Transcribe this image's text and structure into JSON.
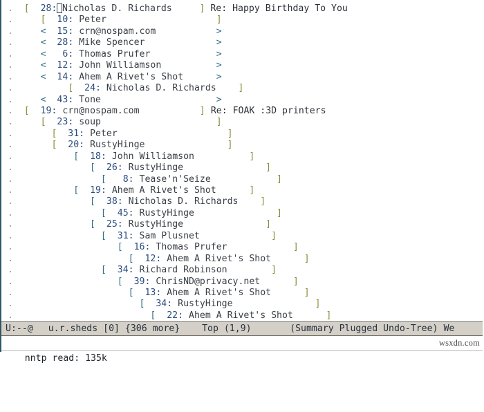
{
  "window": {
    "app": "GNU Emacs - Gnus Summary",
    "frame_border_color": "#2e5866"
  },
  "summary": {
    "dot": ".",
    "lines": [
      {
        "indent": 1,
        "open": "[",
        "close": "]",
        "num": "28",
        "from": "Nicholas D. Richards",
        "pad": 5,
        "cursor_after_num": true,
        "subject": "Re: Happy Birthday To You",
        "root": true
      },
      {
        "indent": 4,
        "open": "[",
        "close": "]",
        "num": "10",
        "from": "Peter",
        "pad": 20,
        "subject": ""
      },
      {
        "indent": 4,
        "open": "<",
        "close": ">",
        "num": "15",
        "from": "crn@nospam.com",
        "pad": 11,
        "subject": ""
      },
      {
        "indent": 4,
        "open": "<",
        "close": ">",
        "num": "28",
        "from": "Mike Spencer",
        "pad": 13,
        "subject": ""
      },
      {
        "indent": 4,
        "open": "<",
        "close": ">",
        "num": "6",
        "from": "Thomas Prufer",
        "pad": 12,
        "subject": ""
      },
      {
        "indent": 4,
        "open": "<",
        "close": ">",
        "num": "12",
        "from": "John Williamson",
        "pad": 10,
        "subject": ""
      },
      {
        "indent": 4,
        "open": "<",
        "close": ">",
        "num": "14",
        "from": "Ahem A Rivet's Shot",
        "pad": 6,
        "subject": ""
      },
      {
        "indent": 9,
        "open": "[",
        "close": "]",
        "num": "24",
        "from": "Nicholas D. Richards",
        "pad": 4,
        "subject": ""
      },
      {
        "indent": 4,
        "open": "<",
        "close": ">",
        "num": "43",
        "from": "Tone",
        "pad": 21,
        "subject": ""
      },
      {
        "indent": 1,
        "open": "[",
        "close": "]",
        "num": "19",
        "from": "crn@nospam.com",
        "pad": 11,
        "subject": "Re: FOAK :3D printers",
        "root": true
      },
      {
        "indent": 4,
        "open": "[",
        "close": "]",
        "num": "23",
        "from": "soup",
        "pad": 21,
        "subject": ""
      },
      {
        "indent": 6,
        "open": "[",
        "close": "]",
        "num": "31",
        "from": "Peter",
        "pad": 20,
        "subject": ""
      },
      {
        "indent": 6,
        "open": "[",
        "close": "]",
        "num": "20",
        "from": "RustyHinge",
        "pad": 15,
        "subject": ""
      },
      {
        "indent": 10,
        "open": "[",
        "close": "]",
        "num": "18",
        "from": "John Williamson",
        "pad": 10,
        "subject": ""
      },
      {
        "indent": 13,
        "open": "[",
        "close": "]",
        "num": "26",
        "from": "RustyHinge",
        "pad": 15,
        "subject": ""
      },
      {
        "indent": 15,
        "open": "[",
        "close": "]",
        "num": "8",
        "from": "Tease'n'Seize",
        "pad": 12,
        "subject": ""
      },
      {
        "indent": 10,
        "open": "[",
        "close": "]",
        "num": "19",
        "from": "Ahem A Rivet's Shot",
        "pad": 6,
        "subject": ""
      },
      {
        "indent": 13,
        "open": "[",
        "close": "]",
        "num": "38",
        "from": "Nicholas D. Richards",
        "pad": 4,
        "subject": ""
      },
      {
        "indent": 15,
        "open": "[",
        "close": "]",
        "num": "45",
        "from": "RustyHinge",
        "pad": 15,
        "subject": ""
      },
      {
        "indent": 13,
        "open": "[",
        "close": "]",
        "num": "25",
        "from": "RustyHinge",
        "pad": 15,
        "subject": ""
      },
      {
        "indent": 15,
        "open": "[",
        "close": "]",
        "num": "31",
        "from": "Sam Plusnet",
        "pad": 13,
        "subject": ""
      },
      {
        "indent": 18,
        "open": "[",
        "close": "]",
        "num": "16",
        "from": "Thomas Prufer",
        "pad": 12,
        "subject": ""
      },
      {
        "indent": 20,
        "open": "[",
        "close": "]",
        "num": "12",
        "from": "Ahem A Rivet's Shot",
        "pad": 6,
        "subject": ""
      },
      {
        "indent": 15,
        "open": "[",
        "close": "]",
        "num": "34",
        "from": "Richard Robinson",
        "pad": 8,
        "subject": ""
      },
      {
        "indent": 18,
        "open": "[",
        "close": "]",
        "num": "39",
        "from": "ChrisND@privacy.net",
        "pad": 6,
        "subject": ""
      },
      {
        "indent": 20,
        "open": "[",
        "close": "]",
        "num": "13",
        "from": "Ahem A Rivet's Shot",
        "pad": 6,
        "subject": ""
      },
      {
        "indent": 22,
        "open": "[",
        "close": "]",
        "num": "34",
        "from": "RustyHinge",
        "pad": 15,
        "subject": ""
      },
      {
        "indent": 24,
        "open": "[",
        "close": "]",
        "num": "22",
        "from": "Ahem A Rivet's Shot",
        "pad": 6,
        "subject": ""
      }
    ]
  },
  "modeline": {
    "mode_flags": "U:--@",
    "icon_name": "gnus-mode-icon",
    "group": "u.r.sheds",
    "unread": "[0]",
    "more": "{306 more}",
    "position": "Top (1,9)",
    "minor_modes": "(Summary Plugged Undo-Tree)",
    "trailing": "We",
    "background": "#d4d0c8"
  },
  "echo": {
    "message": "nntp read: 135k"
  },
  "watermark": {
    "text": "wsxdn.com"
  }
}
